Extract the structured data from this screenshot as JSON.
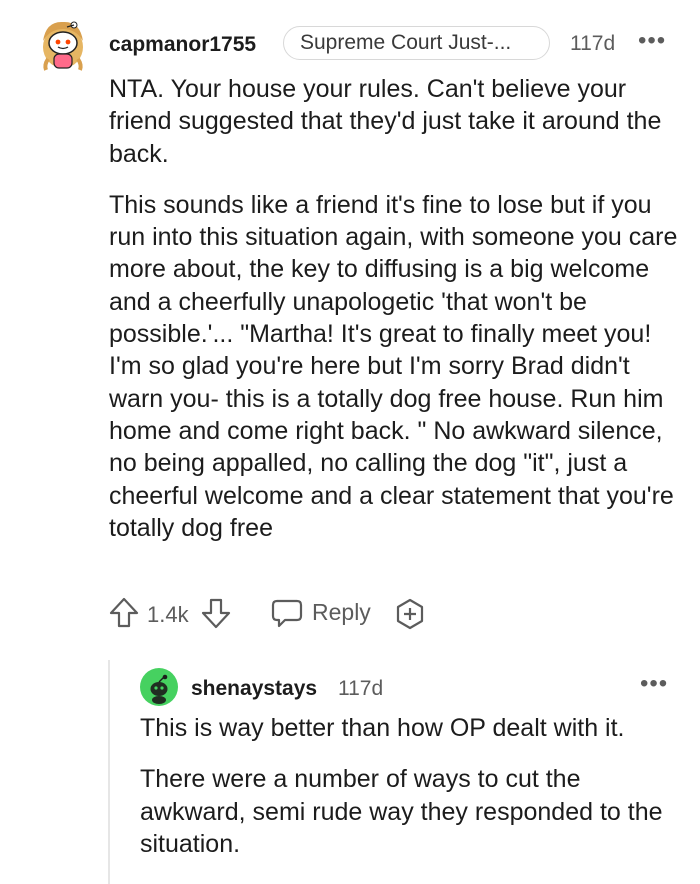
{
  "comment": {
    "username": "capmanor1755",
    "flair": "Supreme Court Just-...",
    "age": "117d",
    "more_icon": "more-horizontal-icon",
    "paragraphs": [
      "NTA. Your house your rules. Can't believe your friend suggested that they'd just take it around the back.",
      "This sounds like a friend it's fine to lose but if you run into this situation again, with someone you care more about, the key to diffusing is a big welcome and a cheerfully unapologetic 'that won't be possible.'... \"Martha! It's great to finally meet you! I'm so glad you're here but I'm sorry Brad didn't warn you- this is a totally dog free house. Run him home and come right back. \" No awkward silence, no being appalled, no calling the dog \"it\", just a cheerful welcome and a clear statement that you're totally dog free"
    ],
    "actions": {
      "upvote_icon": "upvote-arrow-icon",
      "score": "1.4k",
      "downvote_icon": "downvote-arrow-icon",
      "reply_icon": "speech-bubble-icon",
      "reply_label": "Reply",
      "award_icon": "add-award-icon"
    }
  },
  "reply": {
    "username": "shenaystays",
    "age": "117d",
    "more_icon": "more-horizontal-icon",
    "paragraphs": [
      "This is way better than how OP dealt with it.",
      "There were a number of ways to cut the awkward, semi rude way they responded to the situation."
    ]
  },
  "colors": {
    "text": "#1c1c1c",
    "meta": "#5c5c5c",
    "flair_border": "#d8d8d8",
    "reply_avatar_bg": "#46d160",
    "thread_line": "#e6e6e6"
  }
}
